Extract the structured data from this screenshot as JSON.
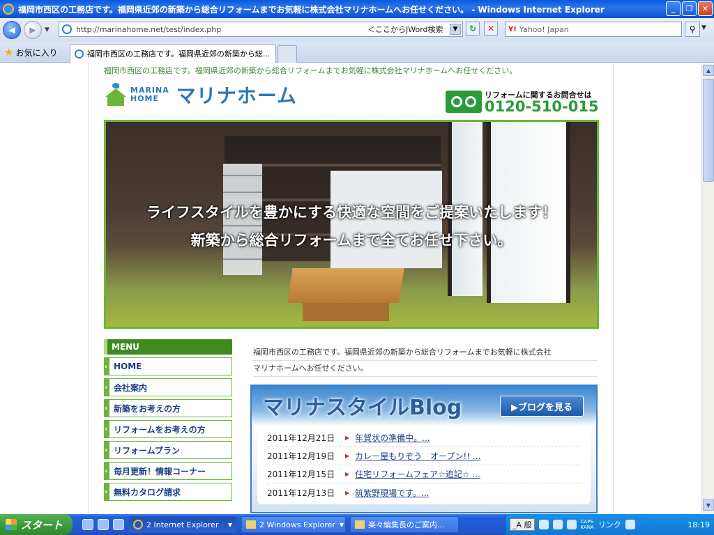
{
  "window": {
    "title": "福岡市西区の工務店です。福岡県近郊の新築から総合リフォームまでお気軽に株式会社マリナホームへお任せください。 - Windows Internet Explorer",
    "minimize": "_",
    "maximize": "❐",
    "close": "✕"
  },
  "nav": {
    "back": "◀",
    "forward": "▶",
    "url": "http://marinahome.net/test/index.php",
    "jword": "＜ここからJWord検索",
    "refresh": "↻",
    "stop": "✕",
    "search_placeholder": "Yahoo! Japan",
    "search_logo": "Y!",
    "search_button": "⚲"
  },
  "favorites": {
    "label": "お気に入り"
  },
  "tab": {
    "label": "福岡市西区の工務店です。福岡県近郊の新築から総..."
  },
  "site": {
    "header_text": "福岡市西区の工務店です。福岡県近郊の新築から総合リフォームまでお気軽に株式会社マリナホームへお任せください。",
    "logo_en_1": "MARINA",
    "logo_en_2": "HOME",
    "logo_jp": "マリナホーム",
    "contact_question": "リフォームに関するお問合せは",
    "contact_number": "0120-510-015",
    "hero_line1": "ライフスタイルを豊かにする快適な空間をご提案いたします！",
    "hero_line2": "新築から総合リフォームまで全てお任せ下さい。",
    "menu_title": "MENU",
    "menu_items": [
      "HOME",
      "会社案内",
      "新築をお考えの方",
      "リフォームをお考えの方",
      "リフォームプラン",
      "毎月更新！情報コーナー",
      "無料カタログ請求"
    ],
    "intro_line1": "福岡市西区の工務店です。福岡県近郊の新築から総合リフォームまでお気軽に株式会社",
    "intro_line2": "マリナホームへお任せください。",
    "blog_title": "マリナスタイルBlog",
    "blog_button": "▶ブログを見る",
    "blog_entries": [
      {
        "date": "2011年12月21日",
        "title": "年賀状の準備中。..."
      },
      {
        "date": "2011年12月19日",
        "title": "カレー屋もりぞう　オープン!! ..."
      },
      {
        "date": "2011年12月15日",
        "title": "住宅リフォームフェア☆追記☆ ..."
      },
      {
        "date": "2011年12月13日",
        "title": "筑紫野現場です。..."
      }
    ]
  },
  "taskbar": {
    "start": "スタート",
    "buttons": [
      "2 Internet Explorer",
      "2 Windows Explorer",
      "楽々編集長のご案内..."
    ],
    "ime": "_A 般",
    "caps": "CAPS",
    "kana": "KANA",
    "link": "リンク",
    "clock": "18:19"
  },
  "colors": {
    "accent_green": "#6bb53a",
    "brand_blue": "#2a78b8",
    "xp_blue": "#245edb"
  }
}
